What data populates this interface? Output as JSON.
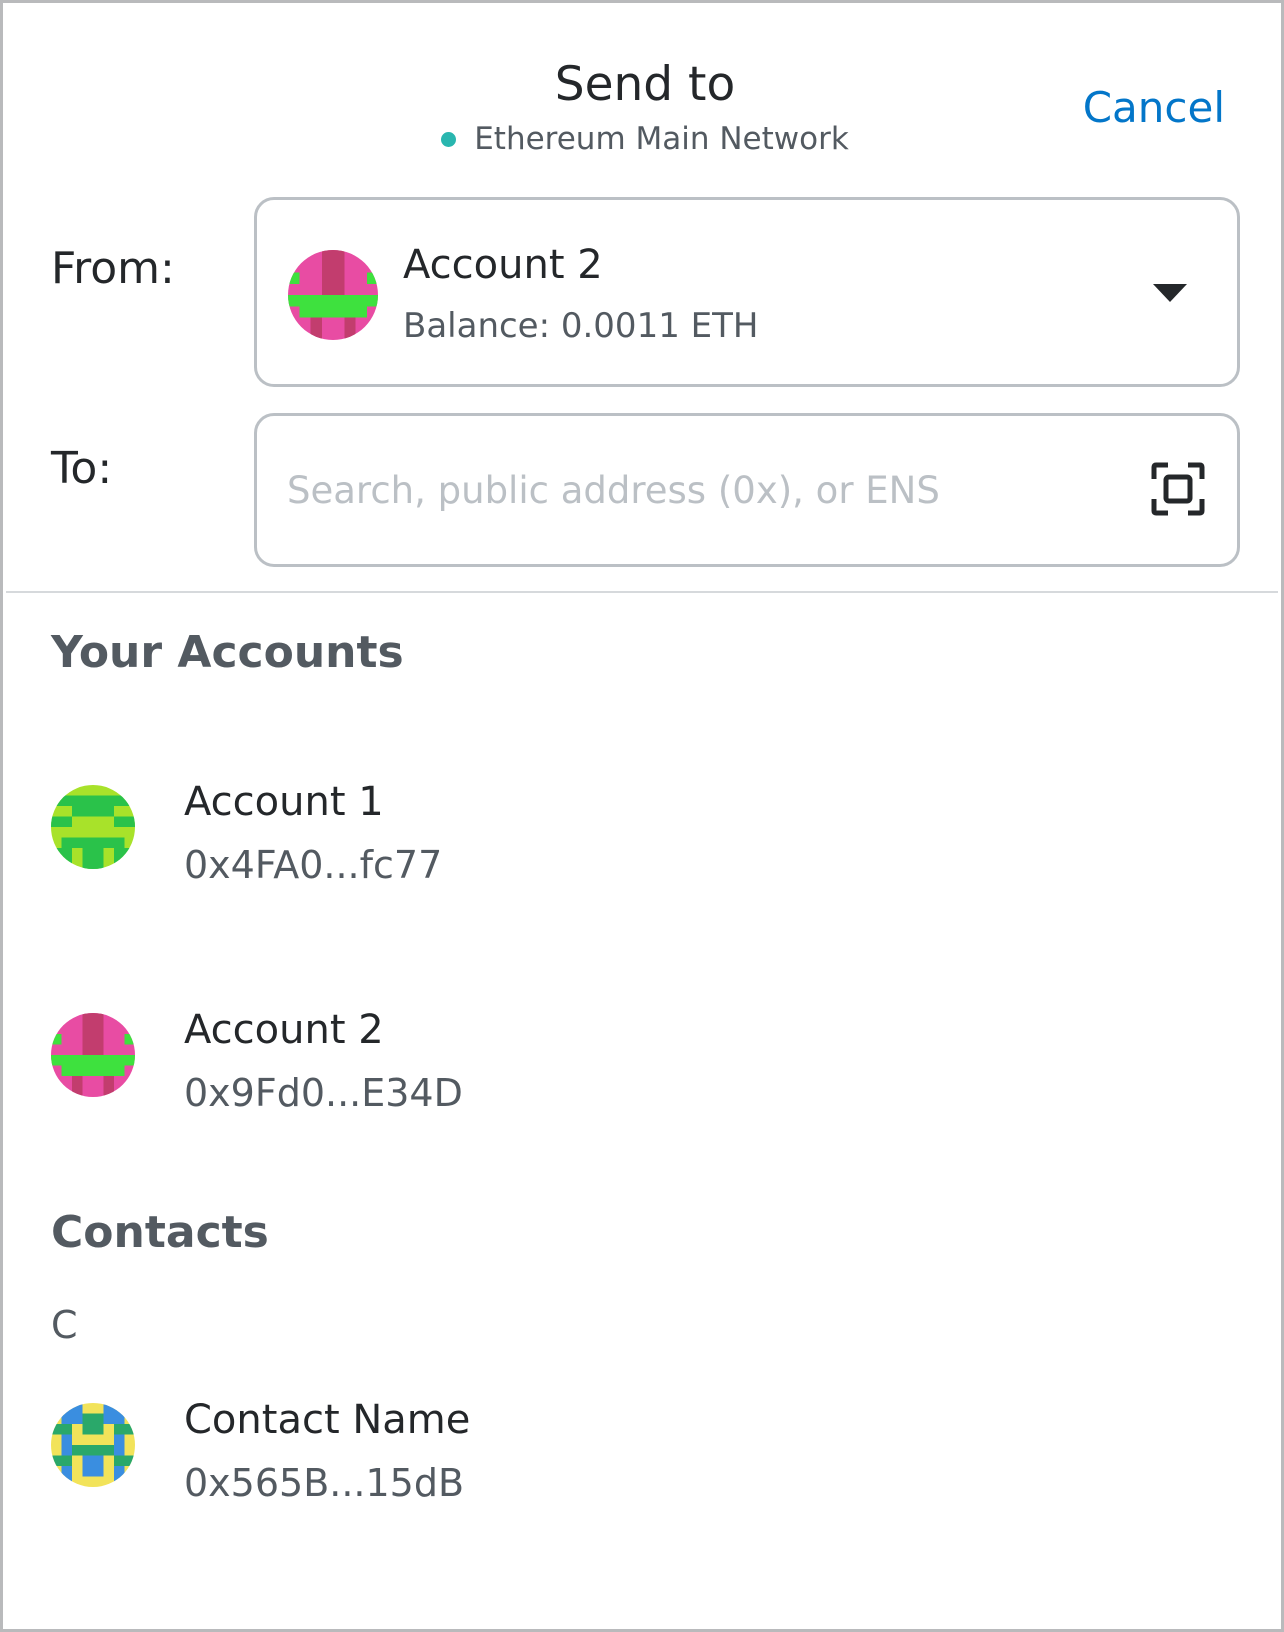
{
  "header": {
    "title": "Send to",
    "network": "Ethereum Main Network",
    "cancel_label": "Cancel"
  },
  "from": {
    "label": "From:",
    "account_name": "Account 2",
    "balance": "Balance: 0.0011 ETH"
  },
  "to": {
    "label": "To:",
    "value": "",
    "placeholder": "Search, public address (0x), or ENS"
  },
  "your_accounts": {
    "title": "Your Accounts",
    "items": [
      {
        "name": "Account 1",
        "address": "0x4FA0...fc77"
      },
      {
        "name": "Account 2",
        "address": "0x9Fd0...E34D"
      }
    ]
  },
  "contacts": {
    "title": "Contacts",
    "groups": [
      {
        "letter": "C",
        "items": [
          {
            "name": "Contact Name",
            "address": "0x565B...15dB"
          }
        ]
      }
    ]
  },
  "colors": {
    "accent": "#0376c9",
    "network_dot": "#29b6af",
    "border": "#bbc0c5",
    "text_primary": "#24272a",
    "text_secondary": "#535a61"
  },
  "icons": {
    "network_status": "network-status-dot-icon",
    "dropdown": "caret-down-icon",
    "scan": "qr-scan-icon",
    "avatar_style": "blockies-identicon"
  }
}
